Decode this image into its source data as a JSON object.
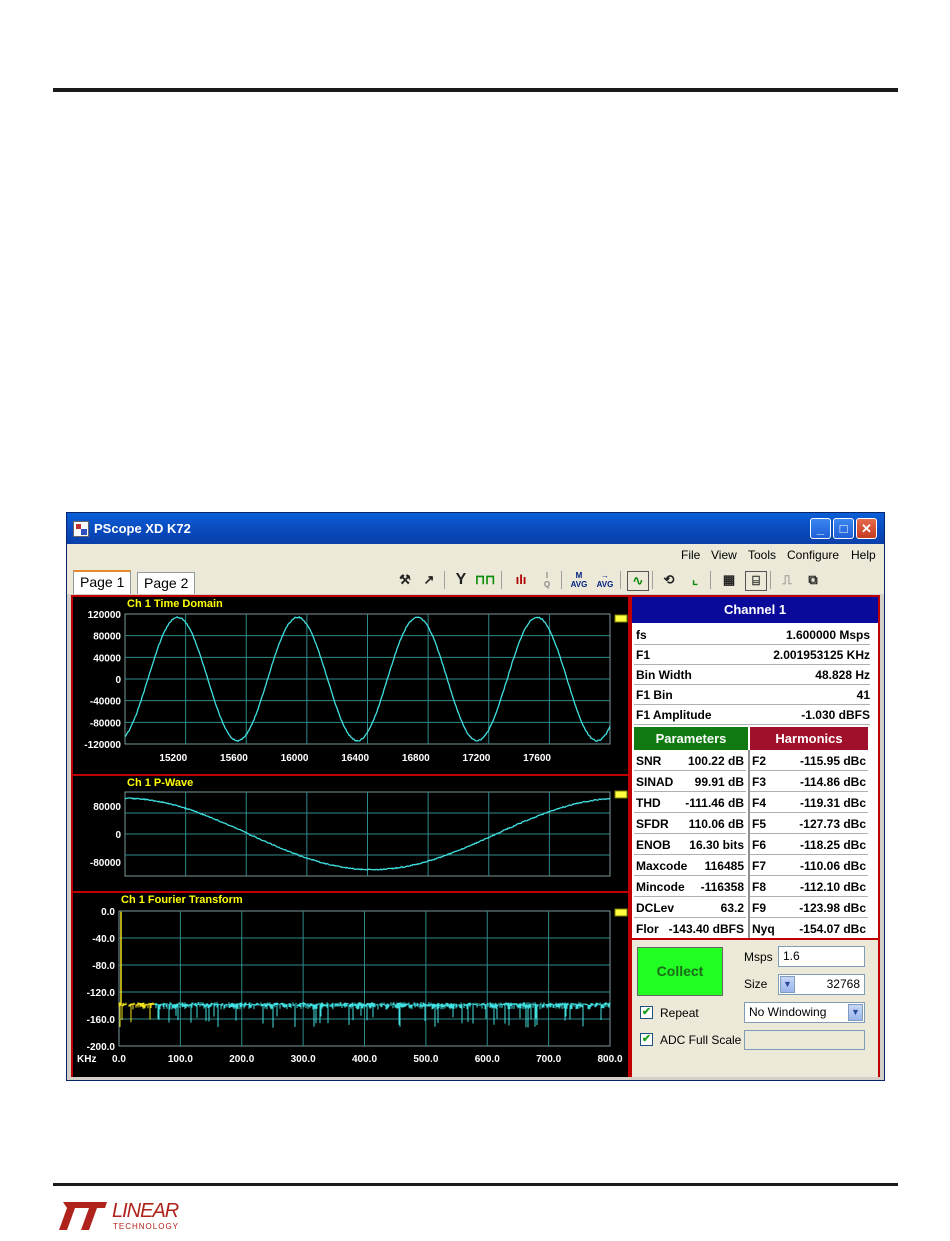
{
  "logo": {
    "lt": "LT",
    "name": "LINEAR",
    "sub": "TECHNOLOGY"
  },
  "window": {
    "title": "PScope XD K72",
    "controls": {
      "minimize": "_",
      "maximize": "□",
      "close": "✕"
    }
  },
  "menu": [
    "File",
    "View",
    "Tools",
    "Configure",
    "Help"
  ],
  "tabs": [
    "Page 1",
    "Page 2"
  ],
  "toolbar_icons": [
    "wand-icon",
    "hammer-icon",
    "filter-icon",
    "pulse-icon",
    "histogram-icon",
    "iq-icon",
    "mavg-icon",
    "arrow-avg-icon",
    "signal-icon",
    "loop-icon",
    "ruler-icon",
    "pan-icon",
    "zoom-icon",
    "step-icon",
    "export-icon"
  ],
  "graphs": {
    "time": {
      "title": "Ch 1 Time Domain",
      "y_ticks": [
        "120000",
        "80000",
        "40000",
        "0",
        "-40000",
        "-80000",
        "-120000"
      ],
      "x_ticks": [
        "15200",
        "15600",
        "16000",
        "16400",
        "16800",
        "17200",
        "17600"
      ]
    },
    "pwave": {
      "title": "Ch 1 P-Wave",
      "y_ticks": [
        "80000",
        "0",
        "-80000"
      ]
    },
    "fft": {
      "title": "Ch 1 Fourier Transform",
      "y_ticks": [
        "0.0",
        "-40.0",
        "-80.0",
        "-120.0",
        "-160.0",
        "-200.0"
      ],
      "x_unit": "KHz",
      "x_ticks": [
        "0.0",
        "100.0",
        "200.0",
        "300.0",
        "400.0",
        "500.0",
        "600.0",
        "700.0",
        "800.0"
      ]
    }
  },
  "channel": {
    "header": "Channel 1",
    "rows": [
      {
        "k": "fs",
        "v": "1.600000 Msps"
      },
      {
        "k": "F1",
        "v": "2.001953125 KHz"
      },
      {
        "k": "Bin Width",
        "v": "48.828 Hz"
      },
      {
        "k": "F1 Bin",
        "v": "41"
      },
      {
        "k": "F1 Amplitude",
        "v": "-1.030 dBFS"
      }
    ]
  },
  "parameters": {
    "header": "Parameters",
    "rows": [
      {
        "k": "SNR",
        "v": "100.22 dB"
      },
      {
        "k": "SINAD",
        "v": "99.91 dB"
      },
      {
        "k": "THD",
        "v": "-111.46 dB"
      },
      {
        "k": "SFDR",
        "v": "110.06 dB"
      },
      {
        "k": "ENOB",
        "v": "16.30 bits"
      },
      {
        "k": "Maxcode",
        "v": "116485"
      },
      {
        "k": "Mincode",
        "v": "-116358"
      },
      {
        "k": "DCLev",
        "v": "63.2"
      },
      {
        "k": "Flor",
        "v": "-143.40 dBFS"
      }
    ]
  },
  "harmonics": {
    "header": "Harmonics",
    "rows": [
      {
        "k": "F2",
        "v": "-115.95 dBc"
      },
      {
        "k": "F3",
        "v": "-114.86 dBc"
      },
      {
        "k": "F4",
        "v": "-119.31 dBc"
      },
      {
        "k": "F5",
        "v": "-127.73 dBc"
      },
      {
        "k": "F6",
        "v": "-118.25 dBc"
      },
      {
        "k": "F7",
        "v": "-110.06 dBc"
      },
      {
        "k": "F8",
        "v": "-112.10 dBc"
      },
      {
        "k": "F9",
        "v": "-123.98 dBc"
      },
      {
        "k": "Nyq",
        "v": "-154.07 dBc"
      }
    ]
  },
  "controls": {
    "collect": "Collect",
    "msps_label": "Msps",
    "msps_value": "1.6",
    "size_label": "Size",
    "size_value": "32768",
    "repeat_label": "Repeat",
    "repeat_checked": true,
    "window_value": "No Windowing",
    "adc_label": "ADC Full Scale",
    "adc_checked": true
  },
  "colors": {
    "trace": "#40e0e0",
    "grid": "#2f8a8a",
    "title": "#ffff00",
    "border": "#c00000",
    "fft_low": "#f0e020"
  }
}
